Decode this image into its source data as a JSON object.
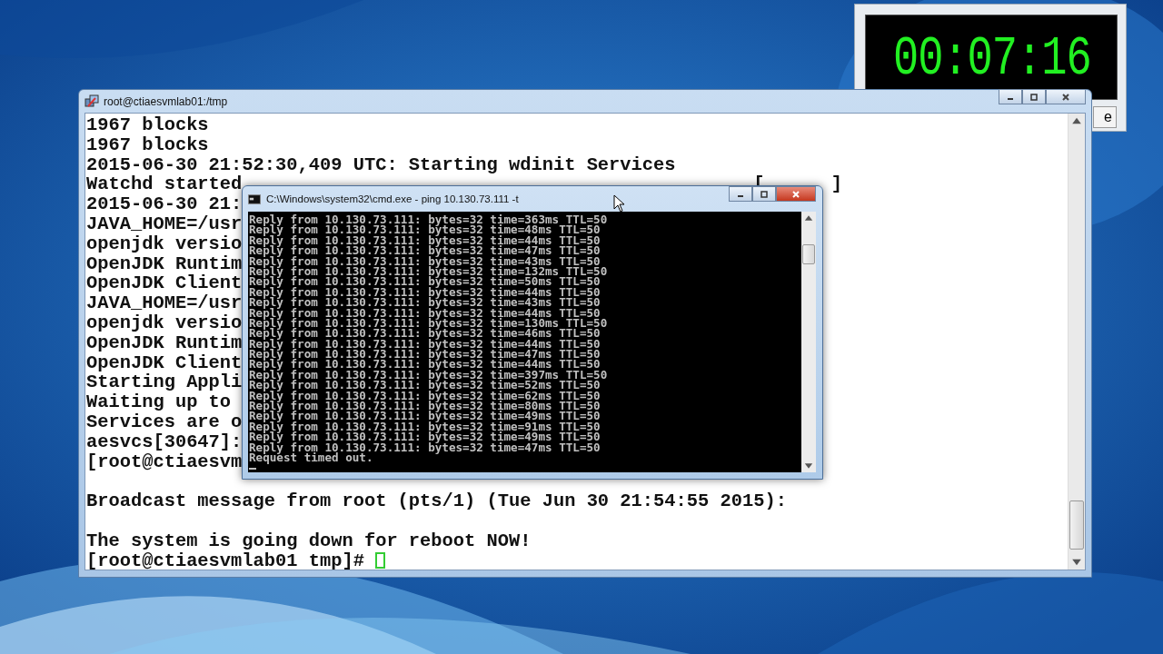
{
  "timer_window": {
    "display": "00:07:16",
    "button_label": "e"
  },
  "terminal_window": {
    "title": "root@ctiaesvmlab01:/tmp",
    "lines": [
      {
        "kind": "text",
        "text": "1967 blocks"
      },
      {
        "kind": "text",
        "text": "1967 blocks"
      },
      {
        "kind": "text",
        "text": "2015-06-30 21:52:30,409 UTC: Starting wdinit Services"
      },
      {
        "kind": "status",
        "text": "Watchd started",
        "status": {
          "open": "[",
          "close": "]"
        }
      },
      {
        "kind": "text",
        "text": "2015-06-30 21:"
      },
      {
        "kind": "text",
        "text": "JAVA_HOME=/usr"
      },
      {
        "kind": "text",
        "text": "openjdk versio"
      },
      {
        "kind": "text",
        "text": "OpenJDK Runtim"
      },
      {
        "kind": "text",
        "text": "OpenJDK Client"
      },
      {
        "kind": "text",
        "text": "JAVA_HOME=/usr"
      },
      {
        "kind": "text",
        "text": "openjdk versio"
      },
      {
        "kind": "text",
        "text": "OpenJDK Runtim"
      },
      {
        "kind": "text",
        "text": "OpenJDK Client"
      },
      {
        "kind": "text",
        "text": "Starting Appli"
      },
      {
        "kind": "text",
        "text": "Waiting up to"
      },
      {
        "kind": "text",
        "text": "Services are o"
      },
      {
        "kind": "text",
        "text": "aesvcs[30647]:"
      },
      {
        "kind": "text",
        "text": "[root@ctiaesvm"
      },
      {
        "kind": "blank"
      },
      {
        "kind": "text",
        "text": "Broadcast message from root (pts/1) (Tue Jun 30 21:54:55 2015):"
      },
      {
        "kind": "blank"
      },
      {
        "kind": "text",
        "text": "The system is going down for reboot NOW!"
      },
      {
        "kind": "prompt",
        "text": "[root@ctiaesvmlab01 tmp]#"
      }
    ]
  },
  "cmd_window": {
    "title": "C:\\Windows\\system32\\cmd.exe - ping  10.130.73.111 -t",
    "lines": [
      "Reply from 10.130.73.111: bytes=32 time=363ms TTL=50",
      "Reply from 10.130.73.111: bytes=32 time=48ms TTL=50",
      "Reply from 10.130.73.111: bytes=32 time=44ms TTL=50",
      "Reply from 10.130.73.111: bytes=32 time=47ms TTL=50",
      "Reply from 10.130.73.111: bytes=32 time=43ms TTL=50",
      "Reply from 10.130.73.111: bytes=32 time=132ms TTL=50",
      "Reply from 10.130.73.111: bytes=32 time=50ms TTL=50",
      "Reply from 10.130.73.111: bytes=32 time=44ms TTL=50",
      "Reply from 10.130.73.111: bytes=32 time=43ms TTL=50",
      "Reply from 10.130.73.111: bytes=32 time=44ms TTL=50",
      "Reply from 10.130.73.111: bytes=32 time=130ms TTL=50",
      "Reply from 10.130.73.111: bytes=32 time=46ms TTL=50",
      "Reply from 10.130.73.111: bytes=32 time=44ms TTL=50",
      "Reply from 10.130.73.111: bytes=32 time=47ms TTL=50",
      "Reply from 10.130.73.111: bytes=32 time=44ms TTL=50",
      "Reply from 10.130.73.111: bytes=32 time=397ms TTL=50",
      "Reply from 10.130.73.111: bytes=32 time=52ms TTL=50",
      "Reply from 10.130.73.111: bytes=32 time=62ms TTL=50",
      "Reply from 10.130.73.111: bytes=32 time=80ms TTL=50",
      "Reply from 10.130.73.111: bytes=32 time=49ms TTL=50",
      "Reply from 10.130.73.111: bytes=32 time=91ms TTL=50",
      "Reply from 10.130.73.111: bytes=32 time=49ms TTL=50",
      "Reply from 10.130.73.111: bytes=32 time=47ms TTL=50",
      "Request timed out."
    ]
  }
}
